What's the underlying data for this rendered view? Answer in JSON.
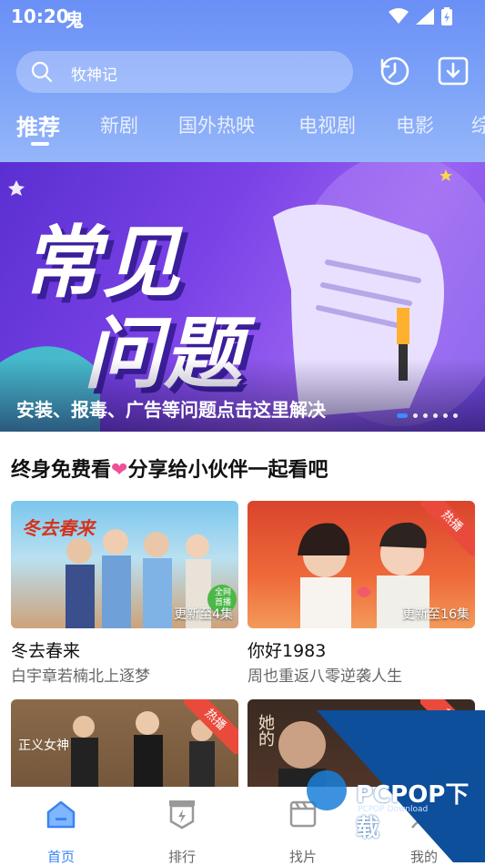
{
  "status_bar": {
    "time": "10:20",
    "notif_glyph": "鬼"
  },
  "search": {
    "placeholder": "牧神记"
  },
  "tabs": [
    {
      "label": "推荐",
      "active": true
    },
    {
      "label": "新剧"
    },
    {
      "label": "国外热映"
    },
    {
      "label": "电视剧"
    },
    {
      "label": "电影"
    },
    {
      "label": "综"
    }
  ],
  "banner": {
    "headline_line1": "常见",
    "headline_line2": "问题",
    "caption": "安装、报毒、广告等问题点击这里解决",
    "dots_count": 6,
    "active_dot": 0
  },
  "section": {
    "title_part1": "终身免费看",
    "heart": "❤",
    "title_part2": "分享给小伙伴一起看吧"
  },
  "cards": [
    {
      "title": "冬去春来",
      "desc": "白宇章若楠北上逐梦",
      "badge": "更新至4集",
      "hot": false,
      "poster_text": "冬去春来",
      "poster_tag": "全网首播"
    },
    {
      "title": "你好1983",
      "desc": "周也重返八零逆袭人生",
      "badge": "更新至16集",
      "hot": true,
      "hot_label": "热播"
    },
    {
      "title": "",
      "desc": "",
      "badge": "",
      "hot": true,
      "hot_label": "热播",
      "poster_text": "正义女神"
    },
    {
      "title": "",
      "desc": "",
      "badge": "",
      "hot": true,
      "hot_label": "热播",
      "poster_text": "她的"
    }
  ],
  "bottom_nav": [
    {
      "label": "首页",
      "icon": "home-icon",
      "active": true
    },
    {
      "label": "排行",
      "icon": "rank-icon"
    },
    {
      "label": "找片",
      "icon": "find-icon"
    },
    {
      "label": "我的",
      "icon": "profile-icon"
    }
  ],
  "watermark": {
    "brand": "PCPOP下载",
    "sub": "PCPOP Download"
  },
  "colors": {
    "accent": "#3a84f0",
    "header_top": "#6a8ff6",
    "hot_ribbon": "#e94a3b",
    "heart": "#f0509a"
  }
}
